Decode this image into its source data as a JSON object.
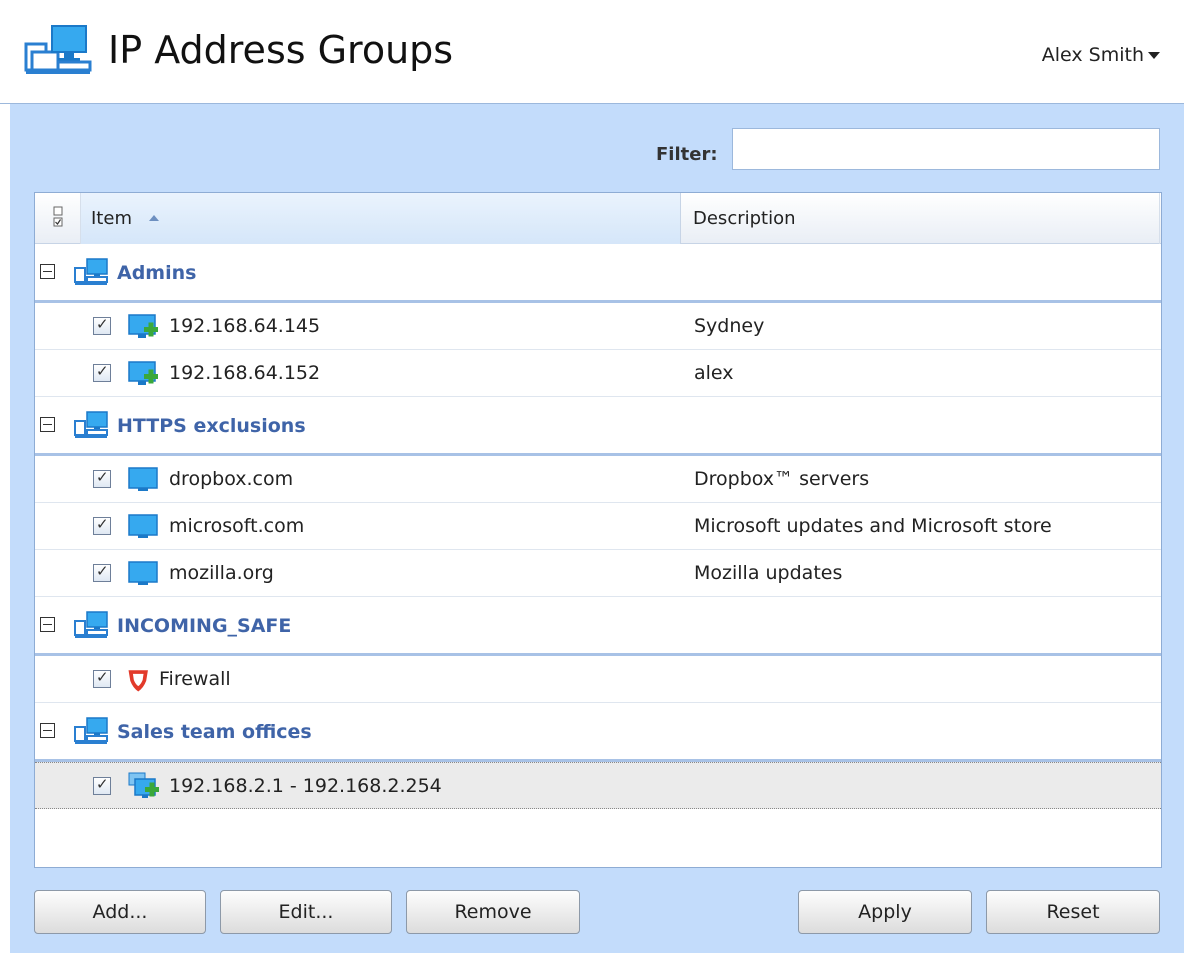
{
  "header": {
    "title": "IP Address Groups",
    "user_name": "Alex Smith"
  },
  "filter": {
    "label": "Filter:",
    "value": "",
    "placeholder": ""
  },
  "table": {
    "columns": {
      "item": "Item",
      "description": "Description"
    },
    "groups": [
      {
        "name": "Admins",
        "items": [
          {
            "name": "192.168.64.145",
            "description": "Sydney",
            "icon": "computer-plus-icon"
          },
          {
            "name": "192.168.64.152",
            "description": "alex",
            "icon": "computer-plus-icon"
          }
        ]
      },
      {
        "name": "HTTPS exclusions",
        "items": [
          {
            "name": "dropbox.com",
            "description": "Dropbox™ servers",
            "icon": "computer-icon"
          },
          {
            "name": "microsoft.com",
            "description": "Microsoft updates and Microsoft store",
            "icon": "computer-icon"
          },
          {
            "name": "mozilla.org",
            "description": "Mozilla updates",
            "icon": "computer-icon"
          }
        ]
      },
      {
        "name": "INCOMING_SAFE",
        "items": [
          {
            "name": "Firewall",
            "description": "",
            "icon": "shield-icon"
          }
        ]
      },
      {
        "name": "Sales team offices",
        "items": [
          {
            "name": "192.168.2.1 - 192.168.2.254",
            "description": "",
            "icon": "computer-range-icon"
          }
        ]
      }
    ]
  },
  "buttons": {
    "add": "Add...",
    "edit": "Edit...",
    "remove": "Remove",
    "apply": "Apply",
    "reset": "Reset"
  },
  "colors": {
    "panel_bg": "#c3dcfb",
    "group_text": "#3f64a8",
    "accent_blue": "#2e9ee8",
    "plus_green": "#3aa83a",
    "shield_red": "#e23a2a"
  }
}
